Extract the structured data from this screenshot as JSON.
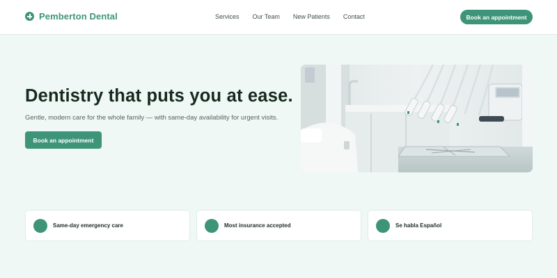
{
  "brand": {
    "name": "Pemberton Dental",
    "logo_icon": "plus-circle-icon",
    "accent_color": "#3e9478"
  },
  "nav": {
    "items": [
      {
        "label": "Services"
      },
      {
        "label": "Our Team"
      },
      {
        "label": "New Patients"
      },
      {
        "label": "Contact"
      }
    ],
    "cta_label": "Book an appointment"
  },
  "hero": {
    "title": "Dentistry that puts you at ease.",
    "subtitle": "Gentle, modern care for the whole family — with same-day availability for urgent visits.",
    "cta_label": "Book an appointment"
  },
  "features": [
    {
      "label": "Same-day emergency care",
      "icon": "dot-icon"
    },
    {
      "label": "Most insurance accepted",
      "icon": "dot-icon"
    },
    {
      "label": "Se habla Español",
      "icon": "dot-icon"
    }
  ]
}
